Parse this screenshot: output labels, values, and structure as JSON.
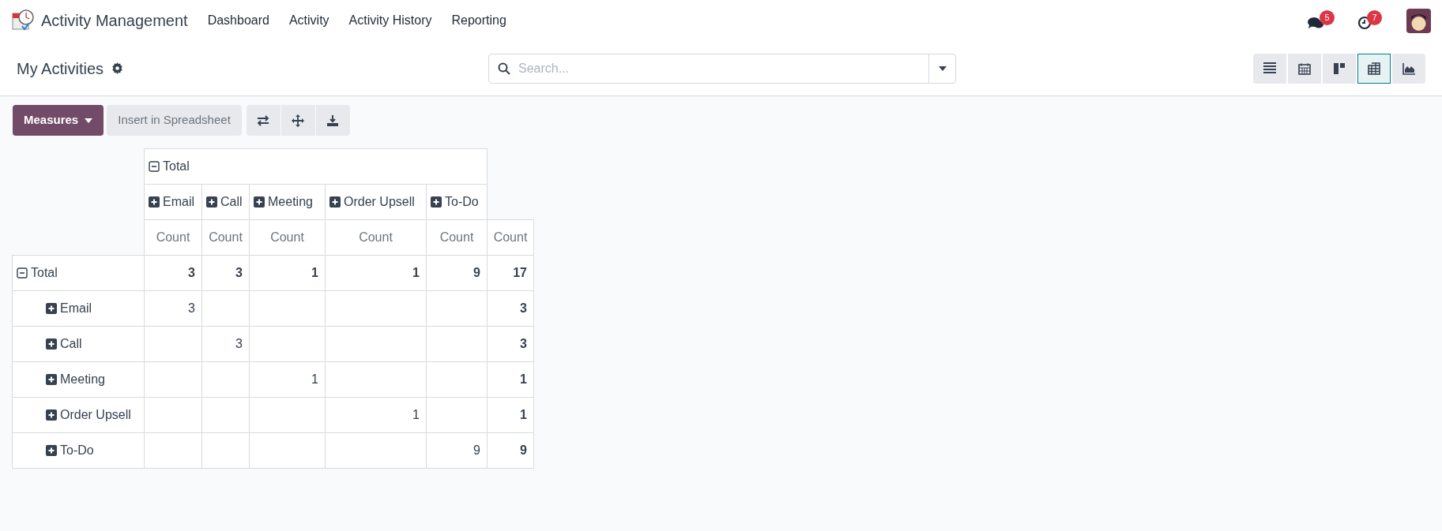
{
  "navbar": {
    "app_name": "Activity Management",
    "menu": [
      "Dashboard",
      "Activity",
      "Activity History",
      "Reporting"
    ],
    "messages_badge": "5",
    "activities_badge": "7"
  },
  "control_panel": {
    "title": "My Activities",
    "search": {
      "placeholder": "Search..."
    },
    "views": [
      {
        "kind": "list",
        "selected": false
      },
      {
        "kind": "calendar",
        "selected": false
      },
      {
        "kind": "kanban",
        "selected": false
      },
      {
        "kind": "pivot",
        "selected": true
      },
      {
        "kind": "graph",
        "selected": false
      }
    ]
  },
  "toolbar": {
    "measures": "Measures",
    "insert": "Insert in Spreadsheet"
  },
  "pivot": {
    "column_header": {
      "label": "Total",
      "expanded": true
    },
    "columns": [
      {
        "label": "Email",
        "expanded": false
      },
      {
        "label": "Call",
        "expanded": false
      },
      {
        "label": "Meeting",
        "expanded": false
      },
      {
        "label": "Order Upsell",
        "expanded": false
      },
      {
        "label": "To-Do",
        "expanded": false
      }
    ],
    "measure_headers": [
      "Count",
      "Count",
      "Count",
      "Count",
      "Count",
      "Count"
    ],
    "rows": [
      {
        "label": "Total",
        "expanded": true,
        "values": {
          "column_1": "3",
          "column_2": "3",
          "column_3": "1",
          "column_4": "1",
          "column_5": "9",
          "total": "17"
        },
        "children": [
          {
            "label": "Email",
            "expanded": false,
            "values": {
              "column_1": "3",
              "total": "3"
            }
          },
          {
            "label": "Call",
            "expanded": false,
            "values": {
              "column_2": "3",
              "total": "3"
            }
          },
          {
            "label": "Meeting",
            "expanded": false,
            "values": {
              "column_3": "1",
              "total": "1"
            }
          },
          {
            "label": "Order Upsell",
            "expanded": false,
            "values": {
              "column_4": "1",
              "total": "1"
            }
          },
          {
            "label": "To-Do",
            "expanded": false,
            "values": {
              "column_5": "9",
              "total": "9"
            }
          }
        ]
      }
    ]
  }
}
